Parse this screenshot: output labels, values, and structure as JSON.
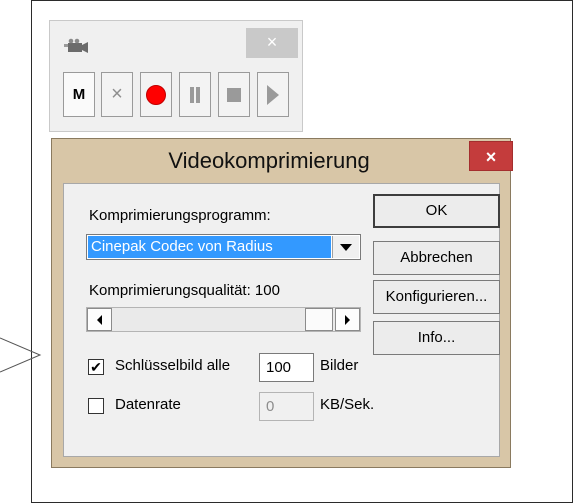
{
  "toolbar": {
    "close_glyph": "×",
    "buttons": {
      "mode_label": "M",
      "cancel_glyph": "×"
    },
    "record_color": "#ff0000",
    "icons": [
      "video-camera-icon",
      "close-icon",
      "record-icon",
      "pause-icon",
      "stop-icon",
      "play-icon"
    ]
  },
  "dialog": {
    "title": "Videokomprimierung",
    "close_glyph": "×",
    "close_color": "#c43c3c",
    "compression_program_label": "Komprimierungsprogramm:",
    "codec_selected": "Cinepak Codec von Radius",
    "quality_label": "Komprimierungsqualität: 100",
    "quality_value": 100,
    "keyframe_checked": true,
    "keyframe_label": "Schlüsselbild alle",
    "keyframe_value": "100",
    "keyframe_unit": "Bilder",
    "datarate_checked": false,
    "datarate_label": "Datenrate",
    "datarate_value": "0",
    "datarate_unit": "KB/Sek.",
    "ok_label": "OK",
    "cancel_label": "Abbrechen",
    "configure_label": "Konfigurieren...",
    "info_label": "Info...",
    "frame_color": "#d8c6a7",
    "selection_color": "#3399ff"
  },
  "marks": {
    "keyframe_check": "✔"
  }
}
